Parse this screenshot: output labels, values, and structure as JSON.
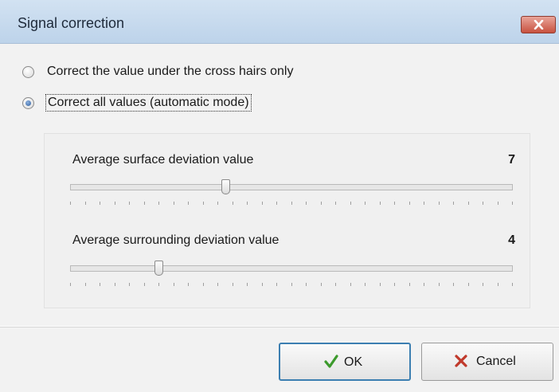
{
  "window": {
    "title": "Signal correction",
    "close_icon": "close-icon"
  },
  "options": [
    {
      "label": "Correct the value under the cross hairs only",
      "checked": false
    },
    {
      "label": "Correct all values (automatic mode)",
      "checked": true
    }
  ],
  "sliders": [
    {
      "label": "Average surface deviation value",
      "value": "7",
      "position_fraction": 0.35
    },
    {
      "label": "Average surrounding deviation value",
      "value": "4",
      "position_fraction": 0.2
    }
  ],
  "buttons": {
    "ok_label": "OK",
    "ok_icon": "checkmark-icon",
    "cancel_label": "Cancel",
    "cancel_icon": "x-icon"
  },
  "colors": {
    "titlebar": "#c9dcf0",
    "ok_icon": "#3c9a2c",
    "cancel_icon": "#c0392b",
    "ok_border": "#3c7fb1"
  }
}
